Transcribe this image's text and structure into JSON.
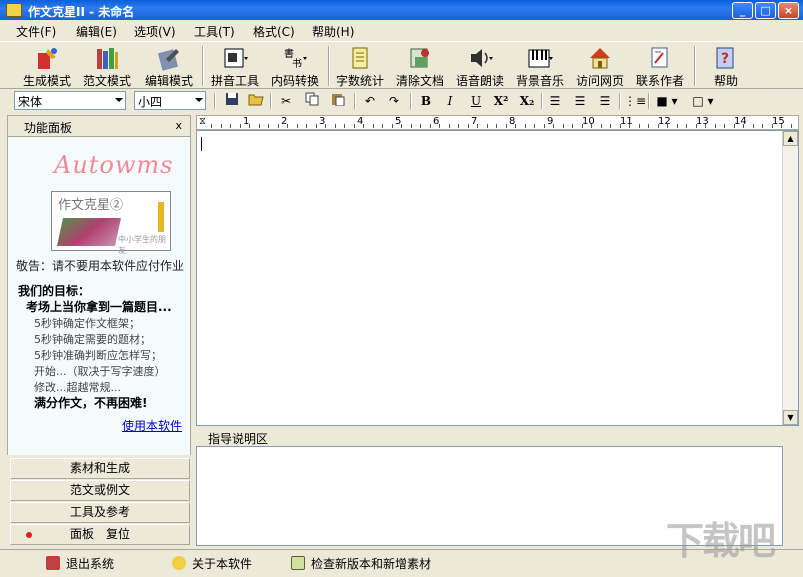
{
  "window": {
    "title": "作文克星II - 未命名",
    "buttons": [
      "_",
      "□",
      "×"
    ]
  },
  "menu": [
    "文件(F)",
    "编辑(E)",
    "选项(V)",
    "工具(T)",
    "格式(C)",
    "帮助(H)"
  ],
  "toolbar": [
    {
      "label": "生成模式",
      "icon": "generate-mode-icon"
    },
    {
      "label": "范文模式",
      "icon": "books-icon"
    },
    {
      "label": "编辑模式",
      "icon": "edit-mode-icon"
    },
    {
      "label": "拼音工具",
      "icon": "pinyin-icon"
    },
    {
      "label": "内码转换",
      "icon": "code-convert-icon"
    },
    {
      "label": "字数统计",
      "icon": "word-count-icon"
    },
    {
      "label": "清除文档",
      "icon": "clear-doc-icon"
    },
    {
      "label": "语音朗读",
      "icon": "speaker-icon"
    },
    {
      "label": "背景音乐",
      "icon": "piano-icon"
    },
    {
      "label": "访问网页",
      "icon": "home-icon"
    },
    {
      "label": "联系作者",
      "icon": "contact-icon"
    },
    {
      "label": "帮助",
      "icon": "help-icon"
    }
  ],
  "format": {
    "font": "宋体",
    "size": "小四",
    "buttons": [
      "B",
      "I",
      "U",
      "X²",
      "X₂"
    ]
  },
  "panel": {
    "title": "功能面板",
    "close": "x",
    "logo": "Autowms",
    "product_name": "作文克星②",
    "product_sub": "中小学生的朋友",
    "warning": "敬告：请不要用本软件应付作业",
    "goal_title": "我们的目标：",
    "goal_sub": "考场上当你拿到一篇题目...",
    "goals": [
      "5秒钟确定作文框架；",
      "5秒钟确定需要的题材；",
      "5秒钟准确判断应怎样写；",
      "开始...（取决于写字速度）",
      "修改...超越常规..."
    ],
    "goal_final": "满分作文，不再困难!",
    "use_link": "使用本软件",
    "sections": [
      "素材和生成",
      "范文或例文",
      "工具及参考"
    ],
    "reset": "面板　复位"
  },
  "ruler": [
    "1",
    "2",
    "3",
    "4",
    "5",
    "6",
    "7",
    "8",
    "9",
    "10",
    "11",
    "12",
    "13",
    "14",
    "15"
  ],
  "guide_title": "指导说明区",
  "status": [
    "退出系统",
    "关于本软件",
    "检查新版本和新增素材"
  ],
  "watermark": "下载吧"
}
